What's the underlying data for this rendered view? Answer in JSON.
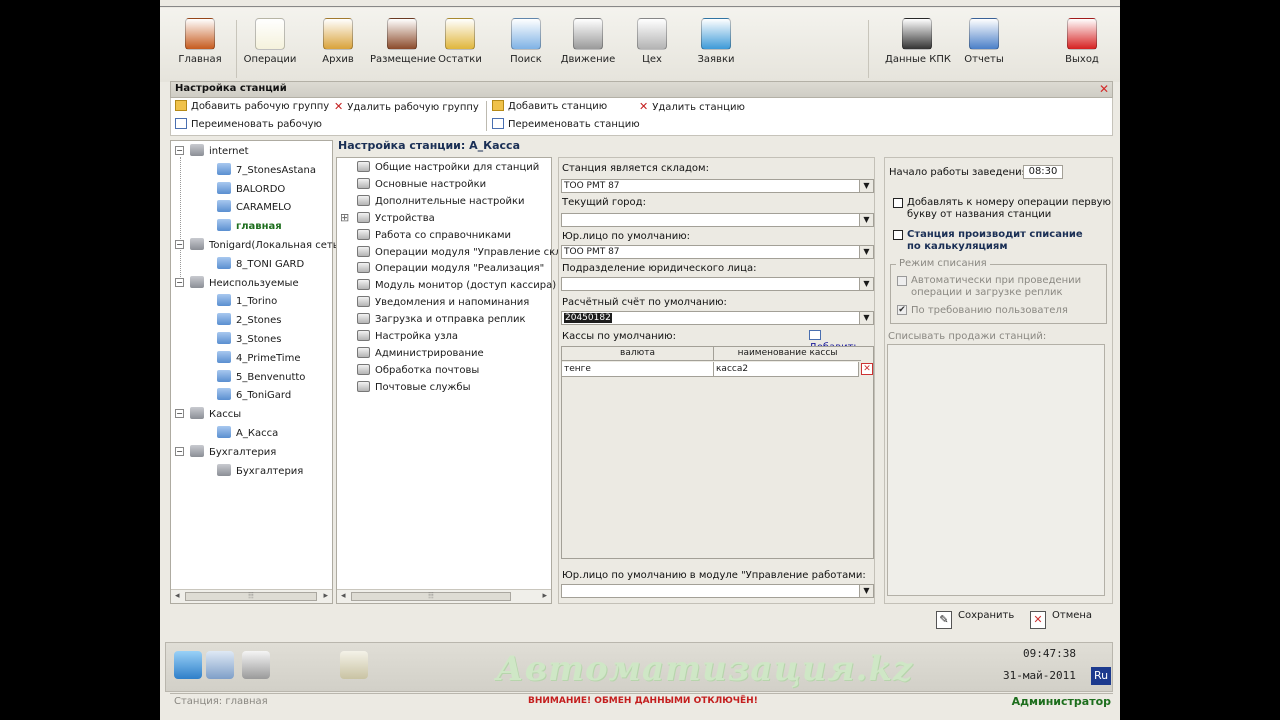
{
  "toolbar": {
    "buttons": [
      {
        "label": "Главная",
        "icon": "home-icon",
        "color": "#c65b1e"
      },
      {
        "label": "Операции",
        "icon": "document-icon",
        "color": "#f5f2dc"
      },
      {
        "label": "Архив",
        "icon": "archive-icon",
        "color": "#d9a23a"
      },
      {
        "label": "Размещение",
        "icon": "cabinet-icon",
        "color": "#8b4a2a"
      },
      {
        "label": "Остатки",
        "icon": "barchart-icon",
        "color": "#e0b63c"
      },
      {
        "label": "Поиск",
        "icon": "magnifier-icon",
        "color": "#7fb2e5"
      },
      {
        "label": "Движение",
        "icon": "satellite-icon",
        "color": "#9a9a9a"
      },
      {
        "label": "Цех",
        "icon": "gear-icon",
        "color": "#b3b3b3"
      },
      {
        "label": "Заявки",
        "icon": "speech-bubble-icon",
        "color": "#3d9ad8"
      },
      {
        "label": "Данные КПК",
        "icon": "pda-icon",
        "color": "#333333"
      },
      {
        "label": "Отчеты",
        "icon": "report-chart-icon",
        "color": "#4a7fc8"
      },
      {
        "label": "Выход",
        "icon": "power-icon",
        "color": "#d62020"
      }
    ]
  },
  "panel": {
    "title": "Настройка станций",
    "actions": {
      "add_group": "Добавить рабочую группу",
      "delete_group": "Удалить рабочую группу",
      "rename_group": "Переименовать рабочую",
      "add_station": "Добавить станцию",
      "delete_station": "Удалить станцию",
      "rename_station": "Переименовать станцию"
    }
  },
  "station_tree": [
    {
      "label": "internet",
      "level": 0,
      "type": "group"
    },
    {
      "label": "7_StonesAstana",
      "level": 1,
      "type": "station"
    },
    {
      "label": "BALORDO",
      "level": 1,
      "type": "station"
    },
    {
      "label": "CARAMELO",
      "level": 1,
      "type": "station"
    },
    {
      "label": "главная",
      "level": 1,
      "type": "station",
      "active": true
    },
    {
      "label": "Tonigard(Локальная сеть",
      "level": 0,
      "type": "group"
    },
    {
      "label": "8_TONI GARD",
      "level": 1,
      "type": "station"
    },
    {
      "label": "Неиспользуемые",
      "level": 0,
      "type": "group"
    },
    {
      "label": "1_Torino",
      "level": 1,
      "type": "station"
    },
    {
      "label": "2_Stones",
      "level": 1,
      "type": "station"
    },
    {
      "label": "3_Stones",
      "level": 1,
      "type": "station"
    },
    {
      "label": "4_PrimeTime",
      "level": 1,
      "type": "station"
    },
    {
      "label": "5_Benvenutto",
      "level": 1,
      "type": "station"
    },
    {
      "label": "6_ToniGard",
      "level": 1,
      "type": "station"
    },
    {
      "label": "Кассы",
      "level": 0,
      "type": "group"
    },
    {
      "label": "A_Касса",
      "level": 1,
      "type": "station"
    },
    {
      "label": "Бухгалтерия",
      "level": 0,
      "type": "group"
    },
    {
      "label": "Бухгалтерия",
      "level": 1,
      "type": "station-grey"
    }
  ],
  "station_title": "Настройка станции: A_Касса",
  "settings_menu": [
    "Общие настройки для станций",
    "Основные настройки",
    "Дополнительные настройки",
    "Устройства",
    "Работа со справочниками",
    "Операции модуля \"Управление склад",
    "Операции модуля \"Реализация\"",
    "Модуль монитор (доступ кассира)",
    "Уведомления и напоминания",
    "Загрузка и отправка реплик",
    "Настройка узла",
    "Администрирование",
    "Обработка почтовы",
    "Почтовые службы"
  ],
  "form": {
    "warehouse_label": "Станция является складом:",
    "warehouse_value": "ТОО РМТ 87",
    "city_label": "Текущий город:",
    "city_value": "",
    "legal_label": "Юр.лицо по умолчанию:",
    "legal_value": "ТОО РМТ 87",
    "division_label": "Подразделение юридического лица:",
    "division_value": "",
    "account_label": "Расчётный счёт по умолчанию:",
    "account_value": "20450182",
    "cash_label": "Кассы по умолчанию:",
    "cash_add": "Добавить",
    "cash_columns": [
      "валюта",
      "наименование кассы"
    ],
    "cash_rows": [
      [
        "тенге",
        "касса2"
      ]
    ],
    "work_legal_label": "Юр.лицо по умолчанию в модуле \"Управление работами:",
    "work_legal_value": ""
  },
  "right_panel": {
    "start_label": "Начало работы заведения",
    "start_time": "08:30",
    "prefix_line1": "Добавлять к номеру операции первую",
    "prefix_line2": "букву от названия станции",
    "writeoff_line1": "Станция производит списание",
    "writeoff_line2": "по калькуляциям",
    "mode_legend": "Режим списания",
    "mode_auto_line1": "Автоматически при проведении",
    "mode_auto_line2": "операции и загрузке реплик",
    "mode_user": "По требованию пользователя",
    "sales_label": "Списывать продажи станций:"
  },
  "buttons": {
    "save": "Сохранить",
    "cancel": "Отмена"
  },
  "status": {
    "watermark": "Автоматизация.kz",
    "time": "09:47:38",
    "date": "31-май-2011",
    "lang": "Ru",
    "station": "Станция: главная",
    "warning": "ВНИМАНИЕ! ОБМЕН ДАННЫМИ ОТКЛЮЧЁН!",
    "user": "Администратор"
  },
  "colors": {
    "accent": "#1a2f55",
    "warning": "#c41e1e",
    "user": "#1d6e1d"
  }
}
